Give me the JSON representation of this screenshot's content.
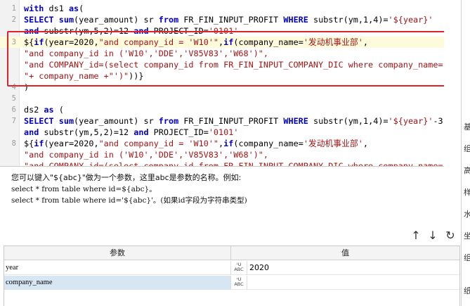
{
  "editor": {
    "lines": [
      {
        "num": "1",
        "code": "with ds1 as("
      },
      {
        "num": "2",
        "code": "SELECT sum(year_amount) sr from FR_FIN_INPUT_PROFIT WHERE substr(ym,1,4)='${year}'"
      },
      {
        "num": "",
        "code": "and substr(ym,5,2)=12 and PROJECT_ID='0101'"
      },
      {
        "num": "3",
        "code": "${if(year=2020,\"and company_id = 'W10'\",if(company_name='发动机事业部',"
      },
      {
        "num": "",
        "code": "\"and company_id in ('W10','DDE','V85V83','W68')\","
      },
      {
        "num": "",
        "code": "\"and COMPANY_id=(select company_id from FR_FIN_INPUT_COMPANY_DIC where company_name='"
      },
      {
        "num": "",
        "code": "\"+ company_name +\"')\"))}"
      },
      {
        "num": "4",
        "code": ")"
      },
      {
        "num": "5",
        "code": ""
      },
      {
        "num": "6",
        "code": "ds2 as ("
      },
      {
        "num": "7",
        "code": "SELECT sum(year_amount) sr from FR_FIN_INPUT_PROFIT WHERE substr(ym,1,4)='${year}'-3"
      },
      {
        "num": "",
        "code": "and substr(ym,5,2)=12 and PROJECT_ID='0101'"
      },
      {
        "num": "8",
        "code": "${if(year=2020,\"and company_id = 'W10'\",if(company_name='发动机事业部',"
      },
      {
        "num": "",
        "code": "\"and company_id in ('W10','DDE','V85V83','W68')\","
      },
      {
        "num": "",
        "code": "\"and COMPANY_id=(select company_id from FR_FIN_INPUT_COMPANY_DIC where company_name='"
      }
    ]
  },
  "hint": {
    "line1": "您可以键入\"${abc}\"做为一个参数，这里abc是参数的名称。例如:",
    "line2": "select * from table where id=${abc}。",
    "line3": "select * from table where id='${abc}'。(如果id字段为字符串类型)"
  },
  "toolbar": {
    "up_icon": "↑",
    "down_icon": "↓",
    "refresh_icon": "↻"
  },
  "params": {
    "header_name": "参数",
    "header_value": "值",
    "type_label_top": "ꜜU",
    "type_label_bottom": "ABC",
    "rows": [
      {
        "name": "year",
        "value": "2020"
      },
      {
        "name": "company_name",
        "value": ""
      }
    ]
  },
  "side_panel": {
    "chars": [
      "基",
      "组",
      "高",
      "样",
      "水",
      "坐",
      "组",
      "纸"
    ]
  },
  "colors": {
    "keyword": "#0000c8",
    "string": "#a31515",
    "highlight_box": "#e0232b",
    "selected_row": "#d6e6f3"
  }
}
